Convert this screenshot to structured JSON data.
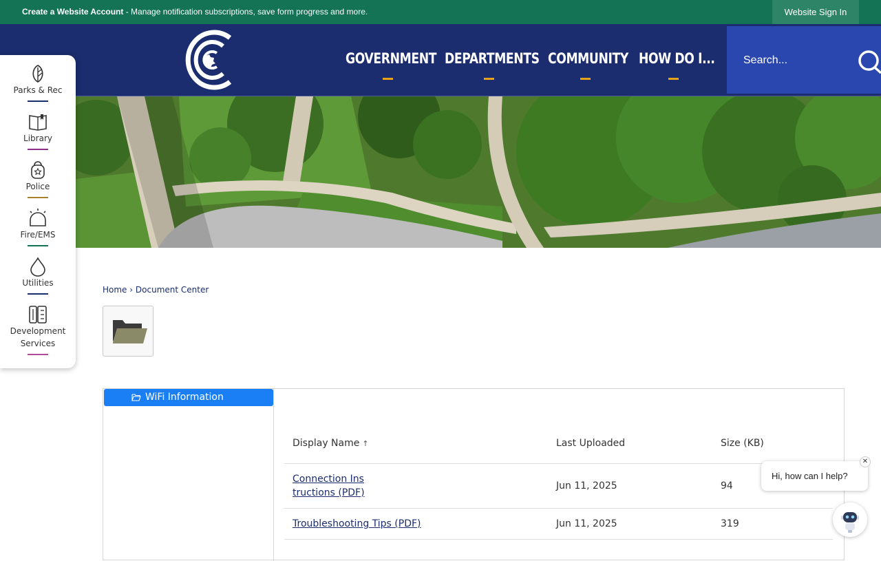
{
  "topbar": {
    "create_account_bold": "Create a Website Account",
    "create_account_rest": " - Manage notification subscriptions, save form progress and more.",
    "signin_label": "Website Sign In"
  },
  "nav": {
    "items": [
      {
        "label": "GOVERNMENT"
      },
      {
        "label": "DEPARTMENTS"
      },
      {
        "label": "COMMUNITY"
      },
      {
        "label": "HOW DO I..."
      }
    ],
    "accent": "#e8a317"
  },
  "search": {
    "placeholder": "Search..."
  },
  "sidebar": {
    "items": [
      {
        "label": "Parks & Rec",
        "icon": "leaf-icon",
        "color": "#1b2d6e"
      },
      {
        "label": "Library",
        "icon": "book-icon",
        "color": "#8b2f8b"
      },
      {
        "label": "Police",
        "icon": "police-badge-icon",
        "color": "#a8802b"
      },
      {
        "label": "Fire/EMS",
        "icon": "siren-icon",
        "color": "#137354"
      },
      {
        "label": "Utilities",
        "icon": "water-drop-icon",
        "color": "#1b2d6e"
      },
      {
        "label": "Development Services",
        "icon": "blueprint-icon",
        "color": "#b24a9b"
      }
    ]
  },
  "breadcrumb": {
    "home": "Home",
    "separator": "›",
    "current": "Document Center"
  },
  "folders": {
    "active": "WiFi Information"
  },
  "table": {
    "headers": {
      "name": "Display Name",
      "name_sort": "↑",
      "uploaded": "Last Uploaded",
      "size": "Size (KB)"
    },
    "rows": [
      {
        "name_line1": "Connection Ins",
        "name_line2": "tructions (PDF)",
        "uploaded": "Jun 11, 2025",
        "size": "94"
      },
      {
        "name": "Troubleshooting Tips (PDF)",
        "uploaded": "Jun 11, 2025",
        "size": "319"
      }
    ]
  },
  "chat": {
    "greeting": "Hi, how can I help?",
    "close": "✕"
  }
}
